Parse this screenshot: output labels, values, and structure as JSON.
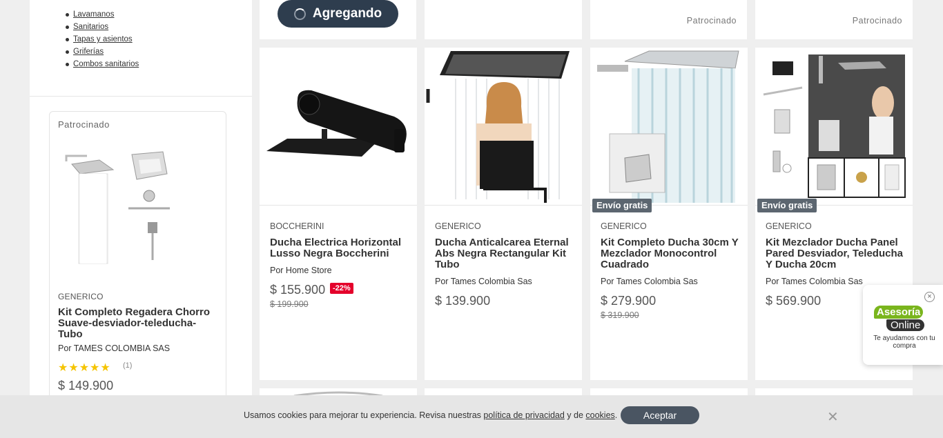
{
  "sidebar": {
    "categories": [
      "Lavamanos",
      "Sanitarios",
      "Tapas y asientos",
      "Griferías",
      "Combos sanitarios"
    ],
    "sponsored_card": {
      "sponsored_label": "Patrocinado",
      "brand": "GENERICO",
      "title": "Kit Completo Regadera Chorro Suave-desviador-teleducha-Tubo",
      "seller": "Por TAMES COLOMBIA SAS",
      "stars": "★★★★★",
      "rating_count": "(1)",
      "price": "$ 149.900"
    }
  },
  "top_row": {
    "adding_label": "Agregando",
    "sponsored_label": "Patrocinado"
  },
  "products": [
    {
      "brand": "BOCCHERINI",
      "title": "Ducha Electrica Horizontal Lusso Negra Boccherini",
      "seller": "Por Home Store",
      "price": "$ 155.900",
      "discount": "-22%",
      "old_price": "$ 199.900",
      "badge": ""
    },
    {
      "brand": "GENERICO",
      "title": "Ducha Anticalcarea Eternal Abs Negra Rectangular Kit Tubo",
      "seller": "Por Tames Colombia Sas",
      "price": "$ 139.900",
      "discount": "",
      "old_price": "",
      "badge": ""
    },
    {
      "brand": "GENERICO",
      "title": "Kit Completo Ducha 30cm Y Mezclador Monocontrol Cuadrado",
      "seller": "Por Tames Colombia Sas",
      "price": "$ 279.900",
      "discount": "",
      "old_price": "$ 319.900",
      "badge": "Envío gratis"
    },
    {
      "brand": "GENERICO",
      "title": "Kit Mezclador Ducha Panel Pared Desviador, Teleducha Y Ducha 20cm",
      "seller": "Por Tames Colombia Sas",
      "price": "$ 569.900",
      "discount": "",
      "old_price": "",
      "badge": "Envío gratis"
    }
  ],
  "asesoria": {
    "close": "×",
    "line1": "Asesoría",
    "line2": "Online",
    "sub": "Te ayudamos con tu compra"
  },
  "cookie_bar": {
    "text_before": "Usamos cookies para mejorar tu experiencia. Revisa nuestras ",
    "privacy_link": "política de privacidad",
    "text_middle": " y de ",
    "cookies_link": "cookies",
    "text_after": ".",
    "accept_label": "Aceptar",
    "close": "✕"
  },
  "colors": {
    "dark_button": "#2e3d4e",
    "discount_red": "#e4002b",
    "badge_gray": "#5c6670",
    "star_yellow": "#f5c400",
    "asesoria_green": "#7ab51d"
  }
}
